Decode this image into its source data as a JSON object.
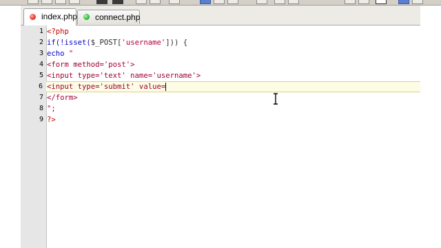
{
  "tabs": [
    {
      "label": "index.php",
      "icon": "php-file-icon-red",
      "color": "#e8372c",
      "active": true
    },
    {
      "label": "connect.php",
      "icon": "php-file-icon-green",
      "color": "#2fbd3a",
      "active": false
    }
  ],
  "editor": {
    "current_line": 6,
    "lines": [
      {
        "num": "1",
        "segments": [
          {
            "t": "<?php",
            "c": "php"
          }
        ]
      },
      {
        "num": "2",
        "segments": [
          {
            "t": "if(!isset(",
            "c": "kw"
          },
          {
            "t": "$_POST[",
            "c": "dark"
          },
          {
            "t": "'username'",
            "c": "str"
          },
          {
            "t": "])) {",
            "c": "dark"
          }
        ]
      },
      {
        "num": "3",
        "segments": [
          {
            "t": "echo ",
            "c": "kw"
          },
          {
            "t": "\"",
            "c": "str"
          }
        ]
      },
      {
        "num": "4",
        "segments": [
          {
            "t": "<form method='post'>",
            "c": "tag"
          }
        ]
      },
      {
        "num": "5",
        "segments": [
          {
            "t": "<input type='text' name='username'>",
            "c": "tag"
          }
        ]
      },
      {
        "num": "6",
        "segments": [
          {
            "t": "<input type='submit' value=",
            "c": "tag"
          }
        ]
      },
      {
        "num": "7",
        "segments": [
          {
            "t": "</form>",
            "c": "tag"
          }
        ]
      },
      {
        "num": "8",
        "segments": [
          {
            "t": "\";",
            "c": "str"
          }
        ]
      },
      {
        "num": "9",
        "segments": [
          {
            "t": "?>",
            "c": "php"
          }
        ]
      }
    ]
  },
  "colors": {
    "php": "#c80000",
    "keyword": "#0000cc",
    "string": "#b4003a",
    "current_line_bg": "#fdfde6"
  }
}
